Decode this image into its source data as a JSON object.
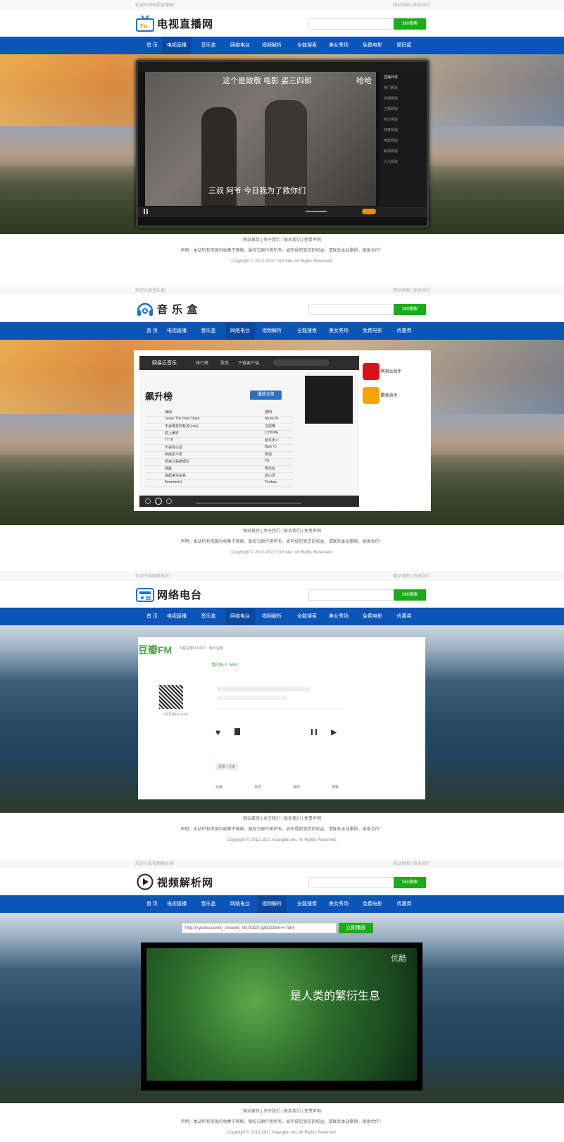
{
  "common": {
    "search_button": "360搜索",
    "nav": [
      "首 页",
      "电视直播",
      "音乐盒",
      "网络电台",
      "视频解析",
      "全能搜索",
      "美女秀场",
      "免费电影"
    ],
    "footer_links": "网站首页 | 关于我们 | 联系我们 | 免责声明",
    "footer_statement": "声明：本站所有资源均收集于网络，版权归原作者所有，如有侵犯到您的权益，请联系本站删除，谢谢合作！"
  },
  "section1": {
    "welcome": "欢迎光临电视直播网!",
    "top_links": "网站地图 | 联系我们",
    "site_name": "电视直播网",
    "nav_last": "聚码屋",
    "subtitle_top": "这个是致敬  电影   姿三四郎",
    "subtitle_top_right": "哈哈",
    "subtitle_bottom": "三叔  阿爷  今日我为了救你们",
    "side_title": "直播列表",
    "side_items": [
      "热门频道",
      "央视频道",
      "卫视频道",
      "地方频道",
      "体育频道",
      "电影频道",
      "新闻频道",
      "少儿频道"
    ],
    "copyright": "Copyright © 2012-2021 Ym3.Net, All Rights Reserved."
  },
  "section2": {
    "welcome": "欢迎光临音乐盒!",
    "top_links": "网站地图 | 联系我们",
    "site_name": "音 乐 盒",
    "nav_last": "优惠券",
    "music_app": "网易云音乐",
    "music_tabs": [
      "排行榜",
      "歌单",
      "下载客户端"
    ],
    "chart_title": "飙升榜",
    "play_all": "播放全部",
    "songs": [
      "海阔",
      "Leave The Door Open",
      "不会再爱你有多(Live)",
      "爱上满岁",
      "TT16",
      "不会有以后",
      "到底爱不爱",
      "原来只是被遗忘",
      "情歌",
      "说起来没关系",
      "flower(mix)"
    ],
    "artists": [
      "游明",
      "Bruno M",
      "马思唯",
      "C.HOPE",
      "结冬无人",
      "Baer Ci",
      "周深",
      "TS",
      "周杰伦",
      "曾心羽",
      "Fenkaa"
    ],
    "side_items": [
      "网易云音乐",
      "酷我音乐"
    ],
    "copyright": "Copyright © 2012-2021 Ym3.Net, All Rights Reserved."
  },
  "section3": {
    "welcome": "欢迎光临网络电台!",
    "top_links": "网站地图 | 联系我们",
    "site_name": "网络电台",
    "nav_last": "优惠券",
    "fm_logo": "豆瓣FM",
    "fm_header": "下载豆瓣FM APP · 我的豆瓣",
    "channel": "我的私人 MHz",
    "qr_caption": "下载豆瓣FM APP",
    "login_tip": "登录 / 注册",
    "bottom_tabs": [
      "兆赫",
      "发现",
      "我的",
      "搜索"
    ],
    "copyright": "Copyright © 2012-2021 huangbin.net, All Rights Reserved."
  },
  "section4": {
    "welcome": "欢迎光临视频解析网!",
    "top_links": "网站地图 | 联系我们",
    "site_name": "视频解析网",
    "nav_last": "优惠券",
    "parse_input": "http://v.youku.com/v_show/id_XNTk3OTg2MzI2MA==.html",
    "parse_button": "立即播放",
    "video_caption": "是人类的繁衍生息",
    "video_brand": "优酷",
    "copyright": "Copyright © 2012-2021 huangbin.net, All Rights Reserved."
  }
}
